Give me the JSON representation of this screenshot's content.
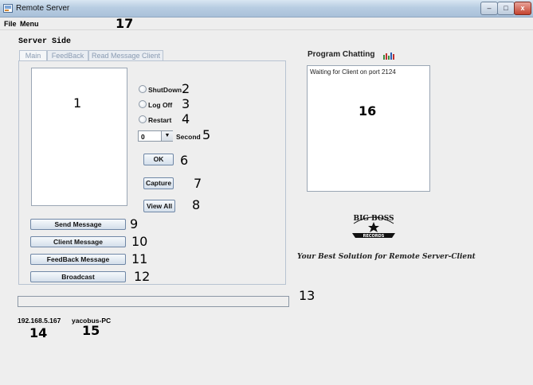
{
  "window": {
    "title": "Remote Server",
    "controls": {
      "minimize": "–",
      "maximize": "□",
      "close": "x"
    }
  },
  "menu": {
    "items": [
      "File",
      "Menu"
    ]
  },
  "server_side_label": "Server Side",
  "tabs": [
    "Main",
    "FeedBack",
    "Read Message Client"
  ],
  "main_panel": {
    "radio_options": [
      "ShutDown",
      "Log Off",
      "Restart"
    ],
    "seconds_value": "0",
    "seconds_label": "Second",
    "buttons": {
      "ok": "OK",
      "capture": "Capture",
      "view_all": "View All"
    },
    "action_buttons": [
      "Send Message",
      "Client Message",
      "FeedBack Message",
      "Broadcast"
    ]
  },
  "chat": {
    "label": "Program Chatting",
    "message": "Waiting for Client on port 2124"
  },
  "logo": {
    "line1": "BIG BOSS",
    "line2": "RECORDS"
  },
  "slogan": "Your Best Solution for Remote Server-Client",
  "status": {
    "ip": "192.168.5.167",
    "host": "yacobus-PC"
  },
  "annotations": [
    "1",
    "2",
    "3",
    "4",
    "5",
    "6",
    "7",
    "8",
    "9",
    "10",
    "11",
    "12",
    "13",
    "14",
    "15",
    "16",
    "17"
  ],
  "colors": {
    "titlebar": "#b8cde2",
    "tab_text": "#8a9bb2",
    "button_border": "#6f87a6",
    "close_button": "#c4432f"
  }
}
